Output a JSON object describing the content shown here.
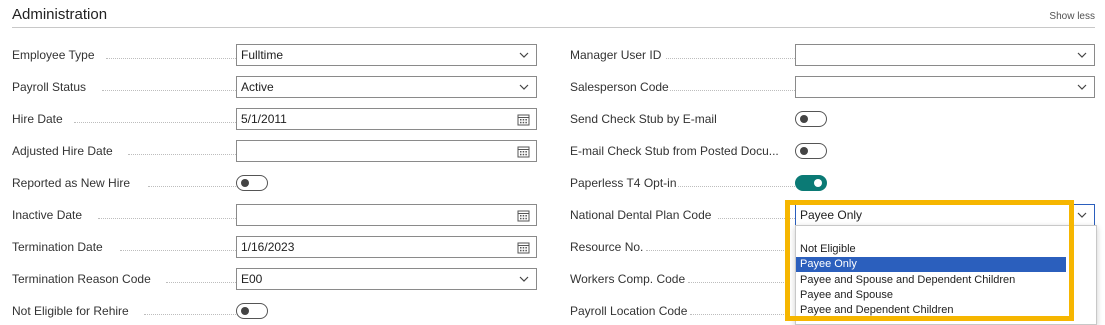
{
  "header": {
    "title": "Administration",
    "show_less": "Show less"
  },
  "left": {
    "employee_type": {
      "label": "Employee Type",
      "value": "Fulltime"
    },
    "payroll_status": {
      "label": "Payroll Status",
      "value": "Active"
    },
    "hire_date": {
      "label": "Hire Date",
      "value": "5/1/2011"
    },
    "adjusted_hire_date": {
      "label": "Adjusted Hire Date",
      "value": ""
    },
    "reported_new_hire": {
      "label": "Reported as New Hire",
      "on": false
    },
    "inactive_date": {
      "label": "Inactive Date",
      "value": ""
    },
    "termination_date": {
      "label": "Termination Date",
      "value": "1/16/2023"
    },
    "termination_reason": {
      "label": "Termination Reason Code",
      "value": "E00"
    },
    "not_eligible_rehire": {
      "label": "Not Eligible for Rehire",
      "on": false
    }
  },
  "right": {
    "manager_user_id": {
      "label": "Manager User ID",
      "value": ""
    },
    "salesperson_code": {
      "label": "Salesperson Code",
      "value": ""
    },
    "send_check_stub": {
      "label": "Send Check Stub by E-mail",
      "on": false
    },
    "email_posted": {
      "label": "E-mail Check Stub from Posted Docu...",
      "on": false
    },
    "paperless_t4": {
      "label": "Paperless T4 Opt-in",
      "on": true
    },
    "dental_plan": {
      "label": "National Dental Plan Code",
      "value": "Payee Only"
    },
    "resource_no": {
      "label": "Resource No."
    },
    "workers_comp": {
      "label": "Workers Comp. Code"
    },
    "payroll_location": {
      "label": "Payroll Location Code"
    }
  },
  "dropdown": {
    "options": [
      "Not Eligible",
      "Payee Only",
      "Payee and Spouse and Dependent Children",
      "Payee and Spouse",
      "Payee and Dependent Children"
    ],
    "selected_index": 1
  },
  "colors": {
    "toggle_on": "#0b7a75",
    "selection": "#2b5fbd",
    "highlight": "#f6b600"
  }
}
